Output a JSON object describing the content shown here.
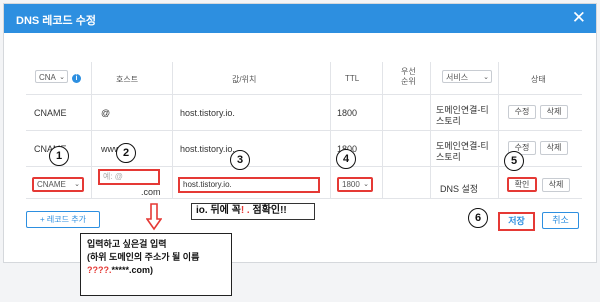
{
  "dialog": {
    "title": "DNS 레코드 수정",
    "close_symbol": "✕"
  },
  "table": {
    "headers": {
      "type_filter": "CNA",
      "host": "호스트",
      "value": "값/위치",
      "ttl": "TTL",
      "priority_line1": "우선",
      "priority_line2": "순위",
      "service_filter": "서비스",
      "status": "상태"
    },
    "rows": [
      {
        "type": "CNAME",
        "host": "@",
        "value": "host.tistory.io.",
        "ttl": "1800",
        "service_line1": "도메인연결-티",
        "service_line2": "스토리",
        "edit": "수정",
        "delete": "삭제"
      },
      {
        "type": "CNAME",
        "host": "www",
        "value": "host.tistory.io.",
        "ttl": "1800",
        "service_line1": "도메인연결-티",
        "service_line2": "스토리",
        "edit": "수정",
        "delete": "삭제"
      }
    ],
    "edit_row": {
      "type": "CNAME",
      "host_placeholder": "예: @",
      "host_suffix": ".com",
      "value": "host.tistory.io.",
      "ttl": "1800",
      "service": "DNS 설정",
      "confirm": "확인",
      "delete": "삭제"
    }
  },
  "footer": {
    "add_record": "+ 레코드 추가",
    "save": "저장",
    "cancel": "취소"
  },
  "annotations": {
    "markers": [
      "1",
      "2",
      "3",
      "4",
      "5",
      "6"
    ],
    "callout_a": "io. 뒤에 꼭",
    "callout_dot": "! . ",
    "callout_b": "점확인!!",
    "note_line1": "입력하고 싶은걸 입력",
    "note_line2": "(하위 도메인의 주소가 될 이름",
    "note_q": "????.",
    "note_rest": "*****.com)"
  },
  "colors": {
    "accent": "#2d8fe0",
    "highlight": "#e53935"
  }
}
